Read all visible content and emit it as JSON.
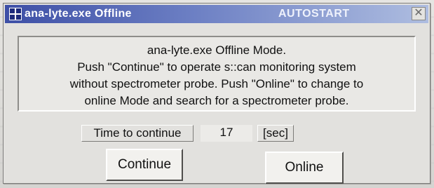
{
  "window": {
    "title": "ana-lyte.exe  Offline",
    "mode": "AUTOSTART",
    "close_glyph": "✕",
    "icon": "app-icon"
  },
  "message": {
    "lines": [
      "ana-lyte.exe Offline Mode.",
      "Push \"Continue\" to operate s::can monitoring system",
      "without spectrometer probe. Push \"Online\" to change to",
      "online Mode and search for a spectrometer probe."
    ]
  },
  "timer": {
    "label": "Time to continue",
    "value": "17",
    "unit": "[sec]"
  },
  "buttons": {
    "continue_label": "Continue",
    "online_label": "Online"
  },
  "colors": {
    "titlebar_start": "#3d4fa6",
    "titlebar_end": "#aebde0",
    "dialog_face": "#e2e1de"
  }
}
